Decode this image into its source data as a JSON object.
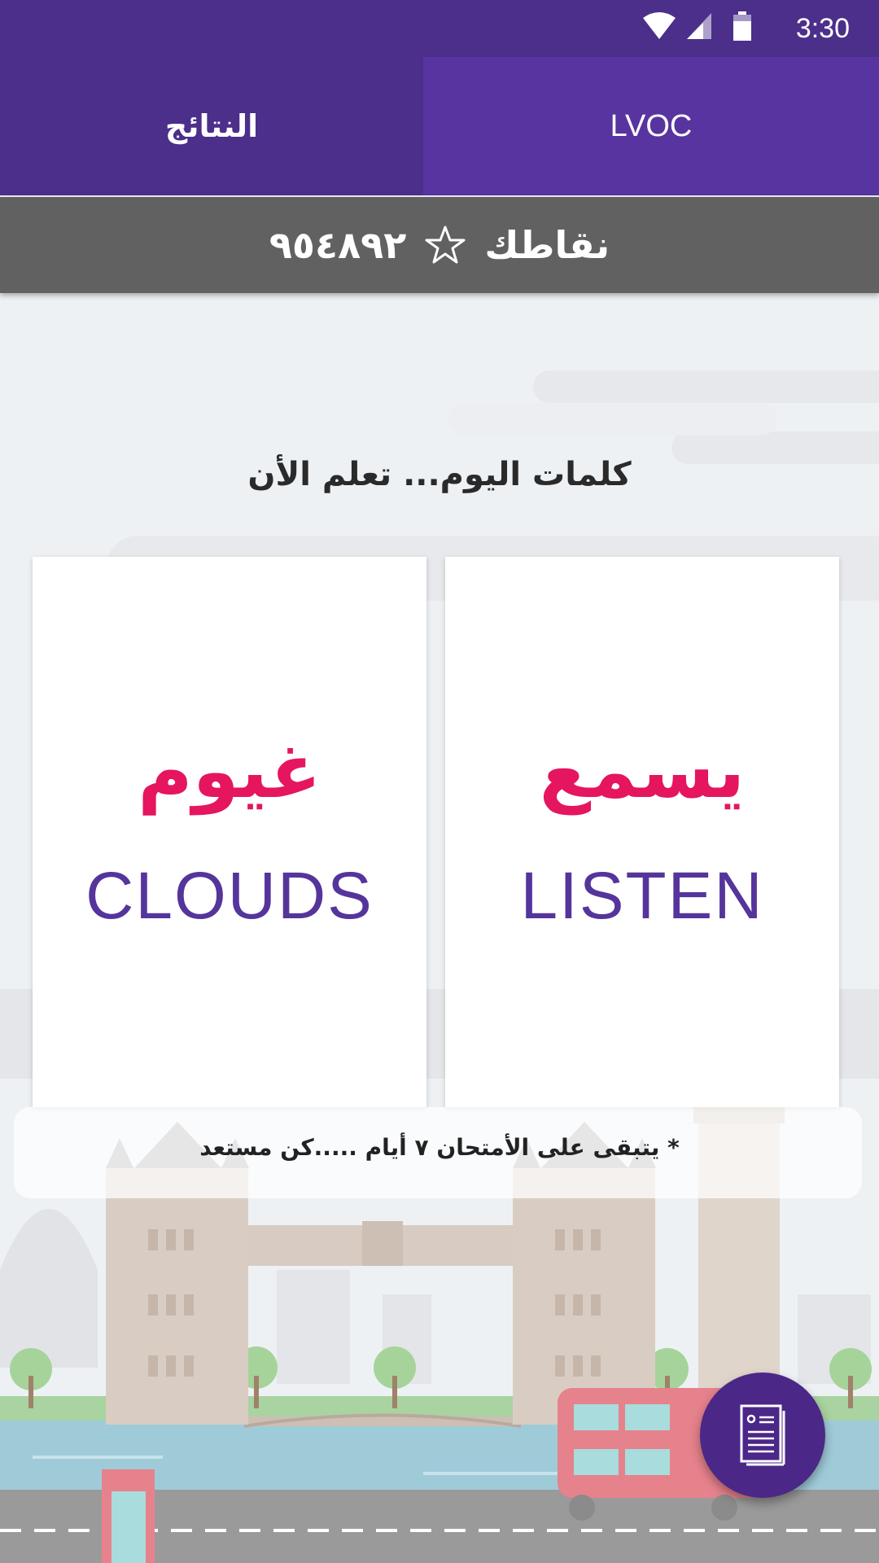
{
  "status_bar": {
    "time": "3:30",
    "icons": [
      "wifi-icon",
      "signal-icon",
      "battery-icon"
    ]
  },
  "tabs": [
    {
      "label": "النتائج",
      "active": true
    },
    {
      "label": "LVOC",
      "active": false
    }
  ],
  "points": {
    "label": "نقاطك",
    "icon": "star-outline-icon",
    "value": "٩٥٤٨٩٢"
  },
  "heading": "كلمات اليوم... تعلم الأن",
  "cards": [
    {
      "arabic": "غيوم",
      "english": "CLOUDS"
    },
    {
      "arabic": "يسمع",
      "english": "LISTEN"
    }
  ],
  "notice": "* يتبقى على الأمتحان ٧ أيام .....كن مستعد",
  "fab": {
    "icon": "document-icon"
  },
  "colors": {
    "primary": "#4b2f8a",
    "tab_active_alt": "#5834a0",
    "accent": "#e5155f",
    "english_text": "#55349c"
  }
}
